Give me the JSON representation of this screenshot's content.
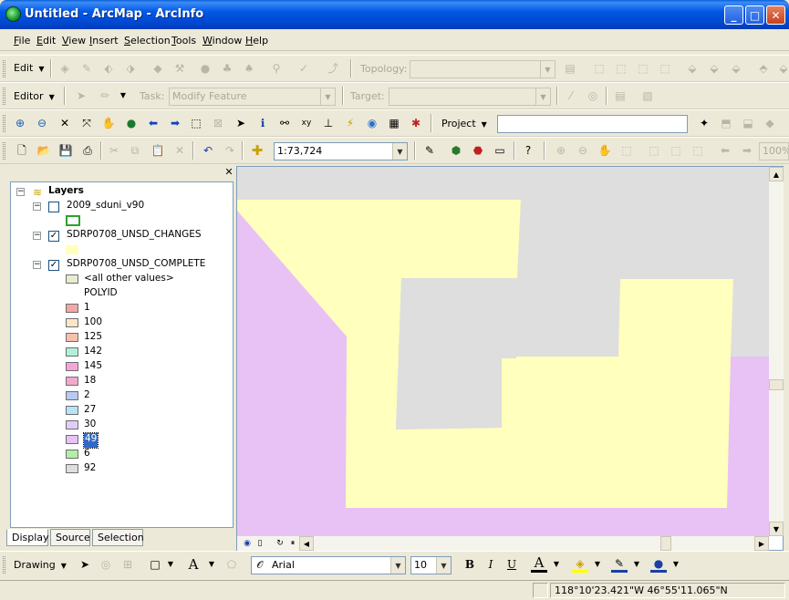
{
  "window": {
    "title": "Untitled - ArcMap - ArcInfo"
  },
  "menu": [
    "File",
    "Edit",
    "View",
    "Insert",
    "Selection",
    "Tools",
    "Window",
    "Help"
  ],
  "topology_toolbar": {
    "edit_label": "Edit",
    "topology_label": "Topology:",
    "topology_value": ""
  },
  "editor_toolbar": {
    "editor_label": "Editor",
    "task_label": "Task:",
    "task_value": "Modify Feature",
    "target_label": "Target:",
    "target_value": ""
  },
  "tools_toolbar": {
    "project_label": "Project",
    "project_value": ""
  },
  "standard_toolbar": {
    "scale": "1:73,724",
    "zoom_percent": "100%"
  },
  "toc": {
    "root": "Layers",
    "layers": [
      {
        "name": "2009_sduni_v90",
        "checked": false,
        "symbol_outline": "#2ea12e"
      },
      {
        "name": "SDRP0708_UNSD_CHANGES",
        "checked": true,
        "symbol_fill": "#ffffbe"
      },
      {
        "name": "SDRP0708_UNSD_COMPLETE",
        "checked": true,
        "other_values_label": "<all other values>",
        "other_values_fill": "#e8ebd0",
        "field_label": "POLYID",
        "classes": [
          {
            "label": "1",
            "color": "#f2a7a7"
          },
          {
            "label": "100",
            "color": "#fde6c8"
          },
          {
            "label": "125",
            "color": "#f7c0aa"
          },
          {
            "label": "142",
            "color": "#b2f0da"
          },
          {
            "label": "145",
            "color": "#f5a5dc"
          },
          {
            "label": "18",
            "color": "#f4a8cb"
          },
          {
            "label": "2",
            "color": "#b8c9f2"
          },
          {
            "label": "27",
            "color": "#b7e4f7"
          },
          {
            "label": "30",
            "color": "#e2cdf5"
          },
          {
            "label": "49",
            "color": "#e8c1f5",
            "selected": true
          },
          {
            "label": "6",
            "color": "#b4eda6"
          },
          {
            "label": "92",
            "color": "#dedede"
          }
        ]
      }
    ],
    "tabs": [
      "Display",
      "Source",
      "Selection"
    ]
  },
  "map_colors": {
    "gray": "#dedede",
    "yellow": "#ffffbe",
    "purple": "#e8c1f5"
  },
  "drawing_toolbar": {
    "drawing_label": "Drawing",
    "font_name": "Arial",
    "font_size": "10"
  },
  "status": {
    "coordinates": "118°10'23.421\"W  46°55'11.065\"N"
  }
}
